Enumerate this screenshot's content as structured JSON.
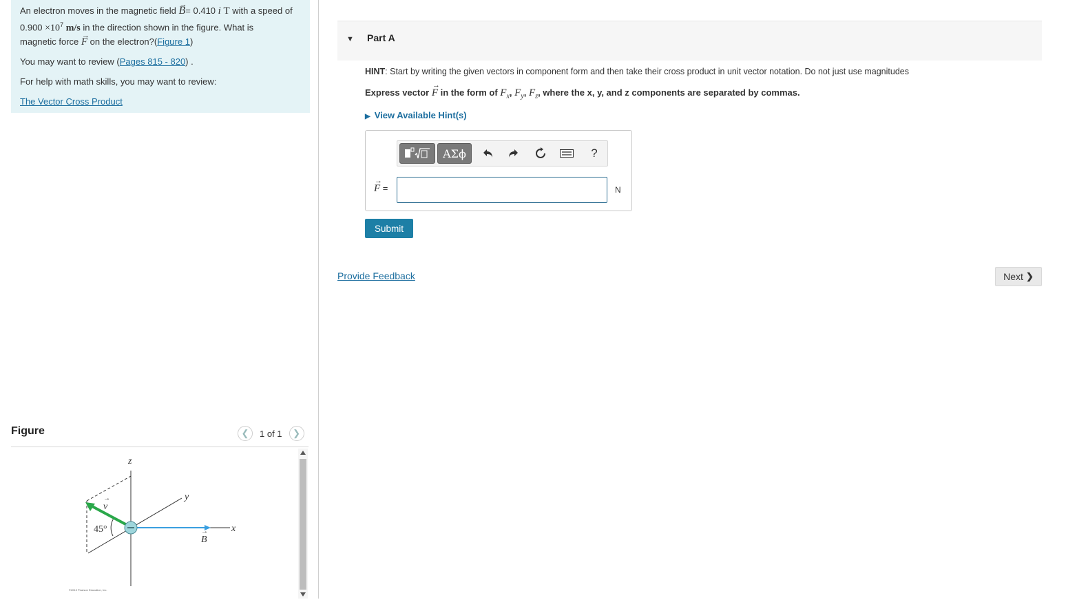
{
  "problem": {
    "line1_pre": "An electron moves in the magnetic field ",
    "b_symbol": "B",
    "line1_eq": "= 0.410 ",
    "i_hat": "i",
    "unit_T": "T",
    "line1_post": " with a speed of",
    "speed_value": "0.900 ",
    "times10": "×10",
    "exp7": "7",
    "speed_unit": "m/s",
    "line2_post": " in the direction shown in the figure. What is",
    "line3_pre": "magnetic force ",
    "f_symbol": "F",
    "line3_post": " on the electron?(",
    "figure_link": "Figure 1",
    "line3_close": ")",
    "review_pre": "You may want to review (",
    "pages_link": "Pages 815 - 820",
    "review_post": ") .",
    "math_help": "For help with math skills, you may want to review:",
    "cross_link": "The Vector Cross Product"
  },
  "figure": {
    "title": "Figure",
    "pager": "1 of 1",
    "axis_z": "z",
    "axis_y": "y",
    "axis_x": "x",
    "v_label": "v",
    "b_label": "B",
    "angle": "45°",
    "copyright": "©2013 Pearson Education, Inc.",
    "colors": {
      "velocity": "#2aa84a",
      "field": "#3a9fe0",
      "electron": "#9fd6dc"
    }
  },
  "partA": {
    "title": "Part A",
    "hint_bold": "HINT",
    "hint_text": ": Start by writing the given vectors in component form and then take their cross product in unit vector notation. Do not just use magnitudes",
    "express_pre": "Express vector ",
    "express_f": "F",
    "express_mid": " in the form of ",
    "fx": "F",
    "fx_sub": "x",
    "fy": "F",
    "fy_sub": "y",
    "fz": "F",
    "fz_sub": "z",
    "comma": ", ",
    "express_post": ", where the x, y, and z components are separated by commas.",
    "view_hints": "View Available Hint(s)",
    "toolbar": {
      "greek": "ΑΣϕ",
      "undo_icon": "undo-icon",
      "redo_icon": "redo-icon",
      "reset_icon": "reset-icon",
      "keyboard_icon": "keyboard-icon",
      "help": "?"
    },
    "answer_label": "F",
    "answer_eq": " =",
    "answer_value": "",
    "unit": "N",
    "submit": "Submit",
    "feedback": "Provide Feedback",
    "next": "Next"
  }
}
